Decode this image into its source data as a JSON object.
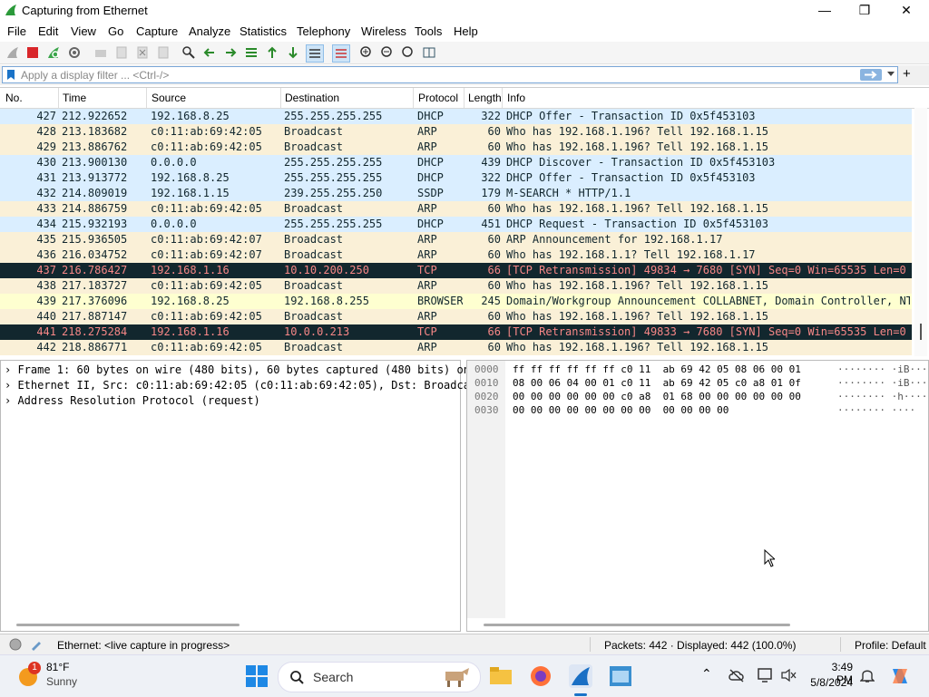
{
  "window": {
    "title": "Capturing from Ethernet",
    "minimize_glyph": "—",
    "maximize_glyph": "❐",
    "close_glyph": "✕"
  },
  "menu": [
    "File",
    "Edit",
    "View",
    "Go",
    "Capture",
    "Analyze",
    "Statistics",
    "Telephony",
    "Wireless",
    "Tools",
    "Help"
  ],
  "filter": {
    "placeholder": "Apply a display filter ... <Ctrl-/>",
    "plus": "+"
  },
  "columns": [
    "No.",
    "Time",
    "Source",
    "Destination",
    "Protocol",
    "Length",
    "Info"
  ],
  "packets": [
    {
      "no": "427",
      "time": "212.922652",
      "src": "192.168.8.25",
      "dst": "255.255.255.255",
      "proto": "DHCP",
      "len": "322",
      "info": "DHCP Offer    - Transaction ID 0x5f453103",
      "bg": "#daeeff",
      "fg": "#12272e"
    },
    {
      "no": "428",
      "time": "213.183682",
      "src": "c0:11:ab:69:42:05",
      "dst": "Broadcast",
      "proto": "ARP",
      "len": "60",
      "info": "Who has 192.168.1.196? Tell 192.168.1.15",
      "bg": "#faf0d7",
      "fg": "#12272e"
    },
    {
      "no": "429",
      "time": "213.886762",
      "src": "c0:11:ab:69:42:05",
      "dst": "Broadcast",
      "proto": "ARP",
      "len": "60",
      "info": "Who has 192.168.1.196? Tell 192.168.1.15",
      "bg": "#faf0d7",
      "fg": "#12272e"
    },
    {
      "no": "430",
      "time": "213.900130",
      "src": "0.0.0.0",
      "dst": "255.255.255.255",
      "proto": "DHCP",
      "len": "439",
      "info": "DHCP Discover - Transaction ID 0x5f453103",
      "bg": "#daeeff",
      "fg": "#12272e"
    },
    {
      "no": "431",
      "time": "213.913772",
      "src": "192.168.8.25",
      "dst": "255.255.255.255",
      "proto": "DHCP",
      "len": "322",
      "info": "DHCP Offer    - Transaction ID 0x5f453103",
      "bg": "#daeeff",
      "fg": "#12272e"
    },
    {
      "no": "432",
      "time": "214.809019",
      "src": "192.168.1.15",
      "dst": "239.255.255.250",
      "proto": "SSDP",
      "len": "179",
      "info": "M-SEARCH * HTTP/1.1",
      "bg": "#daeeff",
      "fg": "#12272e"
    },
    {
      "no": "433",
      "time": "214.886759",
      "src": "c0:11:ab:69:42:05",
      "dst": "Broadcast",
      "proto": "ARP",
      "len": "60",
      "info": "Who has 192.168.1.196? Tell 192.168.1.15",
      "bg": "#faf0d7",
      "fg": "#12272e"
    },
    {
      "no": "434",
      "time": "215.932193",
      "src": "0.0.0.0",
      "dst": "255.255.255.255",
      "proto": "DHCP",
      "len": "451",
      "info": "DHCP Request  - Transaction ID 0x5f453103",
      "bg": "#daeeff",
      "fg": "#12272e"
    },
    {
      "no": "435",
      "time": "215.936505",
      "src": "c0:11:ab:69:42:07",
      "dst": "Broadcast",
      "proto": "ARP",
      "len": "60",
      "info": "ARP Announcement for 192.168.1.17",
      "bg": "#faf0d7",
      "fg": "#12272e"
    },
    {
      "no": "436",
      "time": "216.034752",
      "src": "c0:11:ab:69:42:07",
      "dst": "Broadcast",
      "proto": "ARP",
      "len": "60",
      "info": "Who has 192.168.1.1? Tell 192.168.1.17",
      "bg": "#faf0d7",
      "fg": "#12272e"
    },
    {
      "no": "437",
      "time": "216.786427",
      "src": "192.168.1.16",
      "dst": "10.10.200.250",
      "proto": "TCP",
      "len": "66",
      "info": "[TCP Retransmission] 49834 → 7680 [SYN] Seq=0 Win=65535 Len=0 …",
      "bg": "#12272e",
      "fg": "#f78787"
    },
    {
      "no": "438",
      "time": "217.183727",
      "src": "c0:11:ab:69:42:05",
      "dst": "Broadcast",
      "proto": "ARP",
      "len": "60",
      "info": "Who has 192.168.1.196? Tell 192.168.1.15",
      "bg": "#faf0d7",
      "fg": "#12272e"
    },
    {
      "no": "439",
      "time": "217.376096",
      "src": "192.168.8.25",
      "dst": "192.168.8.255",
      "proto": "BROWSER",
      "len": "245",
      "info": "Domain/Workgroup Announcement COLLABNET, Domain Controller, NT…",
      "bg": "#feffd0",
      "fg": "#12272e"
    },
    {
      "no": "440",
      "time": "217.887147",
      "src": "c0:11:ab:69:42:05",
      "dst": "Broadcast",
      "proto": "ARP",
      "len": "60",
      "info": "Who has 192.168.1.196? Tell 192.168.1.15",
      "bg": "#faf0d7",
      "fg": "#12272e"
    },
    {
      "no": "441",
      "time": "218.275284",
      "src": "192.168.1.16",
      "dst": "10.0.0.213",
      "proto": "TCP",
      "len": "66",
      "info": "[TCP Retransmission] 49833 → 7680 [SYN] Seq=0 Win=65535 Len=0 …",
      "bg": "#12272e",
      "fg": "#f78787"
    },
    {
      "no": "442",
      "time": "218.886771",
      "src": "c0:11:ab:69:42:05",
      "dst": "Broadcast",
      "proto": "ARP",
      "len": "60",
      "info": "Who has 192.168.1.196? Tell 192.168.1.15",
      "bg": "#faf0d7",
      "fg": "#12272e"
    }
  ],
  "details": [
    "Frame 1: 60 bytes on wire (480 bits), 60 bytes captured (480 bits) on",
    "Ethernet II, Src: c0:11:ab:69:42:05 (c0:11:ab:69:42:05), Dst: Broadca",
    "Address Resolution Protocol (request)"
  ],
  "hex": [
    {
      "offset": "0000",
      "bytes": "ff ff ff ff ff ff c0 11  ab 69 42 05 08 06 00 01",
      "ascii": "········ ·iB·····"
    },
    {
      "offset": "0010",
      "bytes": "08 00 06 04 00 01 c0 11  ab 69 42 05 c0 a8 01 0f",
      "ascii": "········ ·iB·····"
    },
    {
      "offset": "0020",
      "bytes": "00 00 00 00 00 00 c0 a8  01 68 00 00 00 00 00 00",
      "ascii": "········ ·h······"
    },
    {
      "offset": "0030",
      "bytes": "00 00 00 00 00 00 00 00  00 00 00 00",
      "ascii": "········ ····"
    }
  ],
  "status": {
    "capture": "Ethernet: <live capture in progress>",
    "packets": "Packets: 442 · Displayed: 442 (100.0%)",
    "profile": "Profile: Default"
  },
  "taskbar": {
    "temp": "81°F",
    "weather": "Sunny",
    "weather_badge": "1",
    "search": "Search",
    "time": "3:49 PM",
    "date": "5/8/2024"
  },
  "colors": {
    "accent": "#1a73c8",
    "arp_row": "#faf0d7",
    "dhcp_row": "#daeeff",
    "tcp_bad_row": "#12272e"
  }
}
